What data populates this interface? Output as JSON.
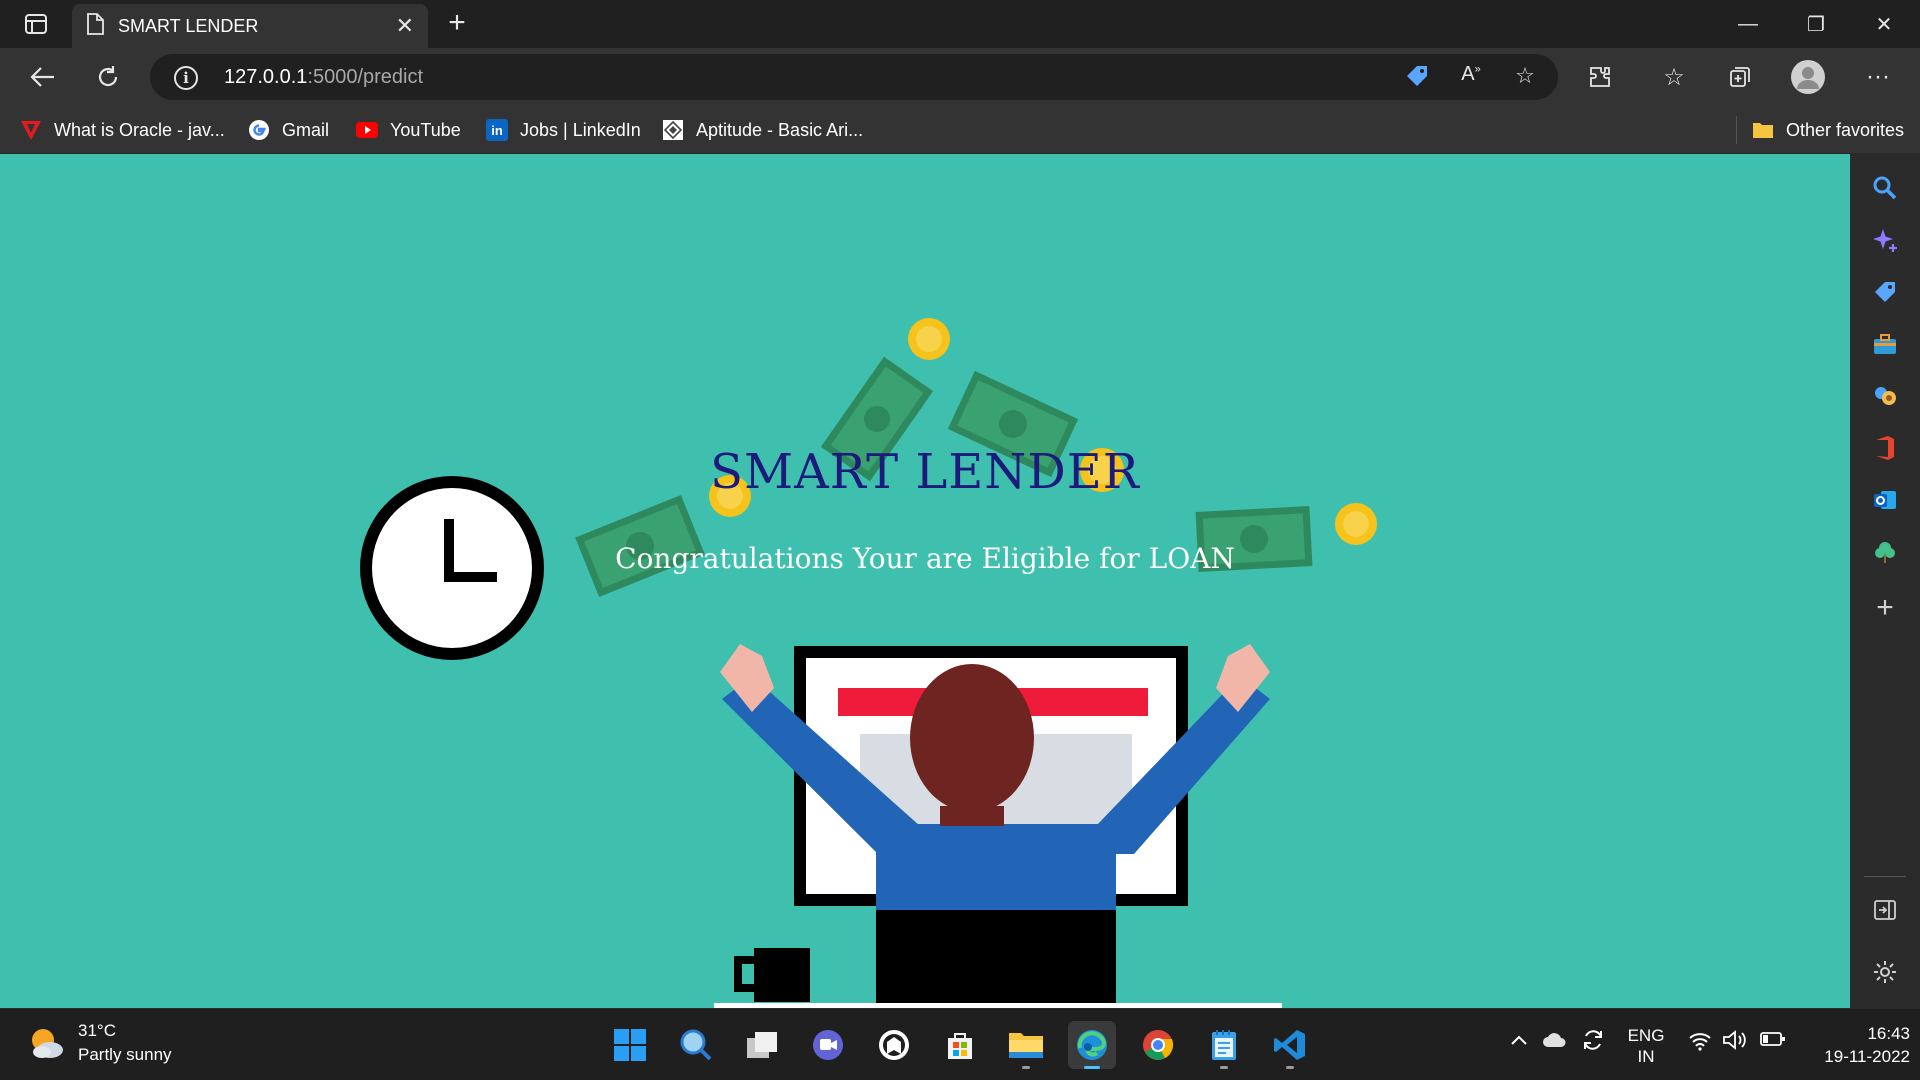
{
  "browser": {
    "tab": {
      "title": "SMART LENDER",
      "close_glyph": "✕"
    },
    "new_tab_glyph": "+",
    "window_controls": {
      "minimize": "—",
      "maximize": "❐",
      "close": "✕"
    },
    "address": {
      "host": "127.0.0.1",
      "path": ":5000/predict"
    },
    "more_glyph": "···"
  },
  "favorites": {
    "items": [
      {
        "label": "What is Oracle - jav...",
        "icon": "oracle-icon"
      },
      {
        "label": "Gmail",
        "icon": "google-icon"
      },
      {
        "label": "YouTube",
        "icon": "youtube-icon"
      },
      {
        "label": "Jobs | LinkedIn",
        "icon": "linkedin-icon"
      },
      {
        "label": "Aptitude - Basic Ari...",
        "icon": "aptitude-icon"
      }
    ],
    "other": "Other favorites"
  },
  "page": {
    "title": "SMART LENDER",
    "subtitle": "Congratulations Your are Eligible for LOAN",
    "background": "#3fbfae"
  },
  "taskbar": {
    "weather": {
      "temp": "31°C",
      "condition": "Partly sunny"
    },
    "language": {
      "line1": "ENG",
      "line2": "IN"
    },
    "clock": {
      "time": "16:43",
      "date": "19-11-2022"
    }
  }
}
